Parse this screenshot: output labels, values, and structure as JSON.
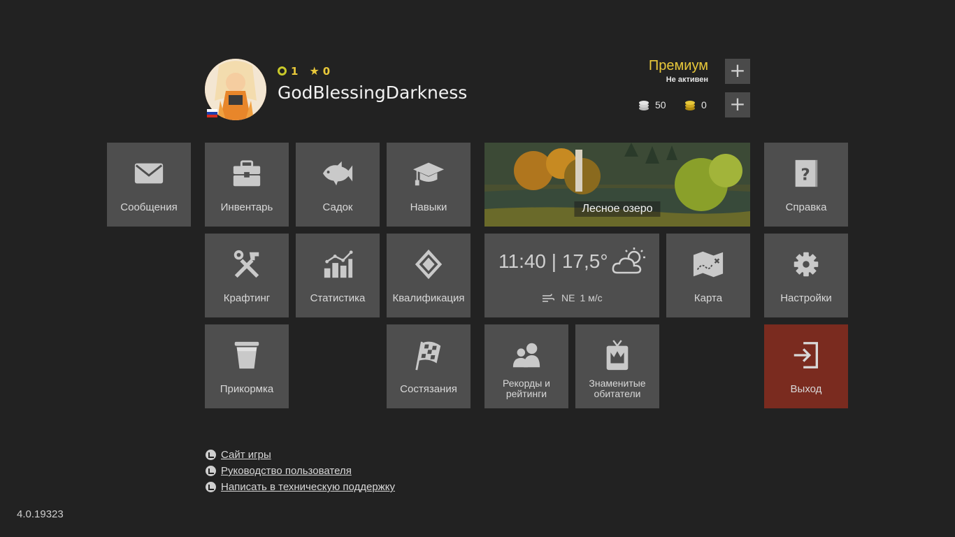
{
  "player": {
    "level": "1",
    "stars": "0",
    "username": "GodBlessingDarkness",
    "flag": "russia-flag-icon"
  },
  "premium": {
    "title": "Премиум",
    "status": "Не активен",
    "add_label": "+"
  },
  "currency": {
    "silver": "50",
    "gold": "0",
    "add_label": "+"
  },
  "tiles": {
    "messages": "Сообщения",
    "inventory": "Инвентарь",
    "keepnet": "Садок",
    "skills": "Навыки",
    "help": "Справка",
    "crafting": "Крафтинг",
    "statistics": "Статистика",
    "qualification": "Квалификация",
    "map": "Карта",
    "settings": "Настройки",
    "groundbait": "Прикормка",
    "competitions": "Состязания",
    "records_line1": "Рекорды и",
    "records_line2": "рейтинги",
    "famous_line1": "Знаменитые",
    "famous_line2": "обитатели",
    "exit": "Выход"
  },
  "location": {
    "name": "Лесное озеро"
  },
  "weather": {
    "time": "11:40",
    "separator": "|",
    "temperature": "17,5°",
    "wind_direction": "NE",
    "wind_speed": "1 м/с"
  },
  "links": [
    "Сайт игры",
    "Руководство пользователя",
    "Написать в техническую поддержку"
  ],
  "version": "4.0.19323",
  "colors": {
    "background": "#222222",
    "tile": "#4e4e4e",
    "exit_tile": "#7a2b1f",
    "accent_yellow": "#e8c83a"
  }
}
